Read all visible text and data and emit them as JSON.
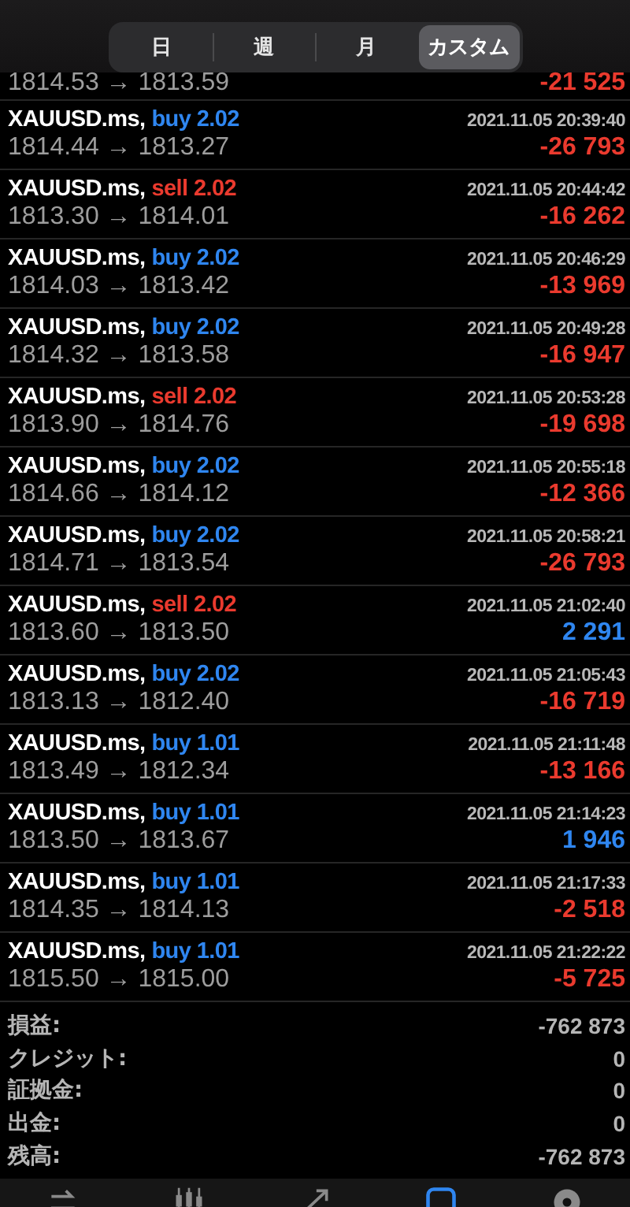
{
  "period_tabs": [
    {
      "label": "日",
      "selected": false
    },
    {
      "label": "週",
      "selected": false
    },
    {
      "label": "月",
      "selected": false
    },
    {
      "label": "カスタム",
      "selected": true
    }
  ],
  "partial_trade": {
    "prices": "1814.53 → 1813.59",
    "profit": "-21 525",
    "color": "#ea3a2e"
  },
  "trades": [
    {
      "symbol": "XAUUSD.ms,",
      "order": "buy 2.02",
      "kind": "buy",
      "time": "2021.11.05 20:39:40",
      "prices": "1814.44 → 1813.27",
      "profit": "-26 793",
      "color": "#ea3a2e"
    },
    {
      "symbol": "XAUUSD.ms,",
      "order": "sell 2.02",
      "kind": "sell",
      "time": "2021.11.05 20:44:42",
      "prices": "1813.30 → 1814.01",
      "profit": "-16 262",
      "color": "#ea3a2e"
    },
    {
      "symbol": "XAUUSD.ms,",
      "order": "buy 2.02",
      "kind": "buy",
      "time": "2021.11.05 20:46:29",
      "prices": "1814.03 → 1813.42",
      "profit": "-13 969",
      "color": "#ea3a2e"
    },
    {
      "symbol": "XAUUSD.ms,",
      "order": "buy 2.02",
      "kind": "buy",
      "time": "2021.11.05 20:49:28",
      "prices": "1814.32 → 1813.58",
      "profit": "-16 947",
      "color": "#ea3a2e"
    },
    {
      "symbol": "XAUUSD.ms,",
      "order": "sell 2.02",
      "kind": "sell",
      "time": "2021.11.05 20:53:28",
      "prices": "1813.90 → 1814.76",
      "profit": "-19 698",
      "color": "#ea3a2e"
    },
    {
      "symbol": "XAUUSD.ms,",
      "order": "buy 2.02",
      "kind": "buy",
      "time": "2021.11.05 20:55:18",
      "prices": "1814.66 → 1814.12",
      "profit": "-12 366",
      "color": "#ea3a2e"
    },
    {
      "symbol": "XAUUSD.ms,",
      "order": "buy 2.02",
      "kind": "buy",
      "time": "2021.11.05 20:58:21",
      "prices": "1814.71 → 1813.54",
      "profit": "-26 793",
      "color": "#ea3a2e"
    },
    {
      "symbol": "XAUUSD.ms,",
      "order": "sell 2.02",
      "kind": "sell",
      "time": "2021.11.05 21:02:40",
      "prices": "1813.60 → 1813.50",
      "profit": "2 291",
      "color": "#2f86f0"
    },
    {
      "symbol": "XAUUSD.ms,",
      "order": "buy 2.02",
      "kind": "buy",
      "time": "2021.11.05 21:05:43",
      "prices": "1813.13 → 1812.40",
      "profit": "-16 719",
      "color": "#ea3a2e"
    },
    {
      "symbol": "XAUUSD.ms,",
      "order": "buy 1.01",
      "kind": "buy",
      "time": "2021.11.05 21:11:48",
      "prices": "1813.49 → 1812.34",
      "profit": "-13 166",
      "color": "#ea3a2e"
    },
    {
      "symbol": "XAUUSD.ms,",
      "order": "buy 1.01",
      "kind": "buy",
      "time": "2021.11.05 21:14:23",
      "prices": "1813.50 → 1813.67",
      "profit": "1 946",
      "color": "#2f86f0"
    },
    {
      "symbol": "XAUUSD.ms,",
      "order": "buy 1.01",
      "kind": "buy",
      "time": "2021.11.05 21:17:33",
      "prices": "1814.35 → 1814.13",
      "profit": "-2 518",
      "color": "#ea3a2e"
    },
    {
      "symbol": "XAUUSD.ms,",
      "order": "buy 1.01",
      "kind": "buy",
      "time": "2021.11.05 21:22:22",
      "prices": "1815.50 → 1815.00",
      "profit": "-5 725",
      "color": "#ea3a2e"
    }
  ],
  "summary": [
    {
      "label": "損益:",
      "value": "-762 873"
    },
    {
      "label": "クレジット:",
      "value": "0"
    },
    {
      "label": "証拠金:",
      "value": "0"
    },
    {
      "label": "出金:",
      "value": "0"
    },
    {
      "label": "残高:",
      "value": "-762 873"
    }
  ],
  "tab_bar": [
    {
      "kind": "quotes",
      "selected": false
    },
    {
      "kind": "chart",
      "selected": false
    },
    {
      "kind": "trade",
      "selected": false
    },
    {
      "kind": "history",
      "selected": true
    },
    {
      "kind": "settings",
      "selected": false
    }
  ]
}
